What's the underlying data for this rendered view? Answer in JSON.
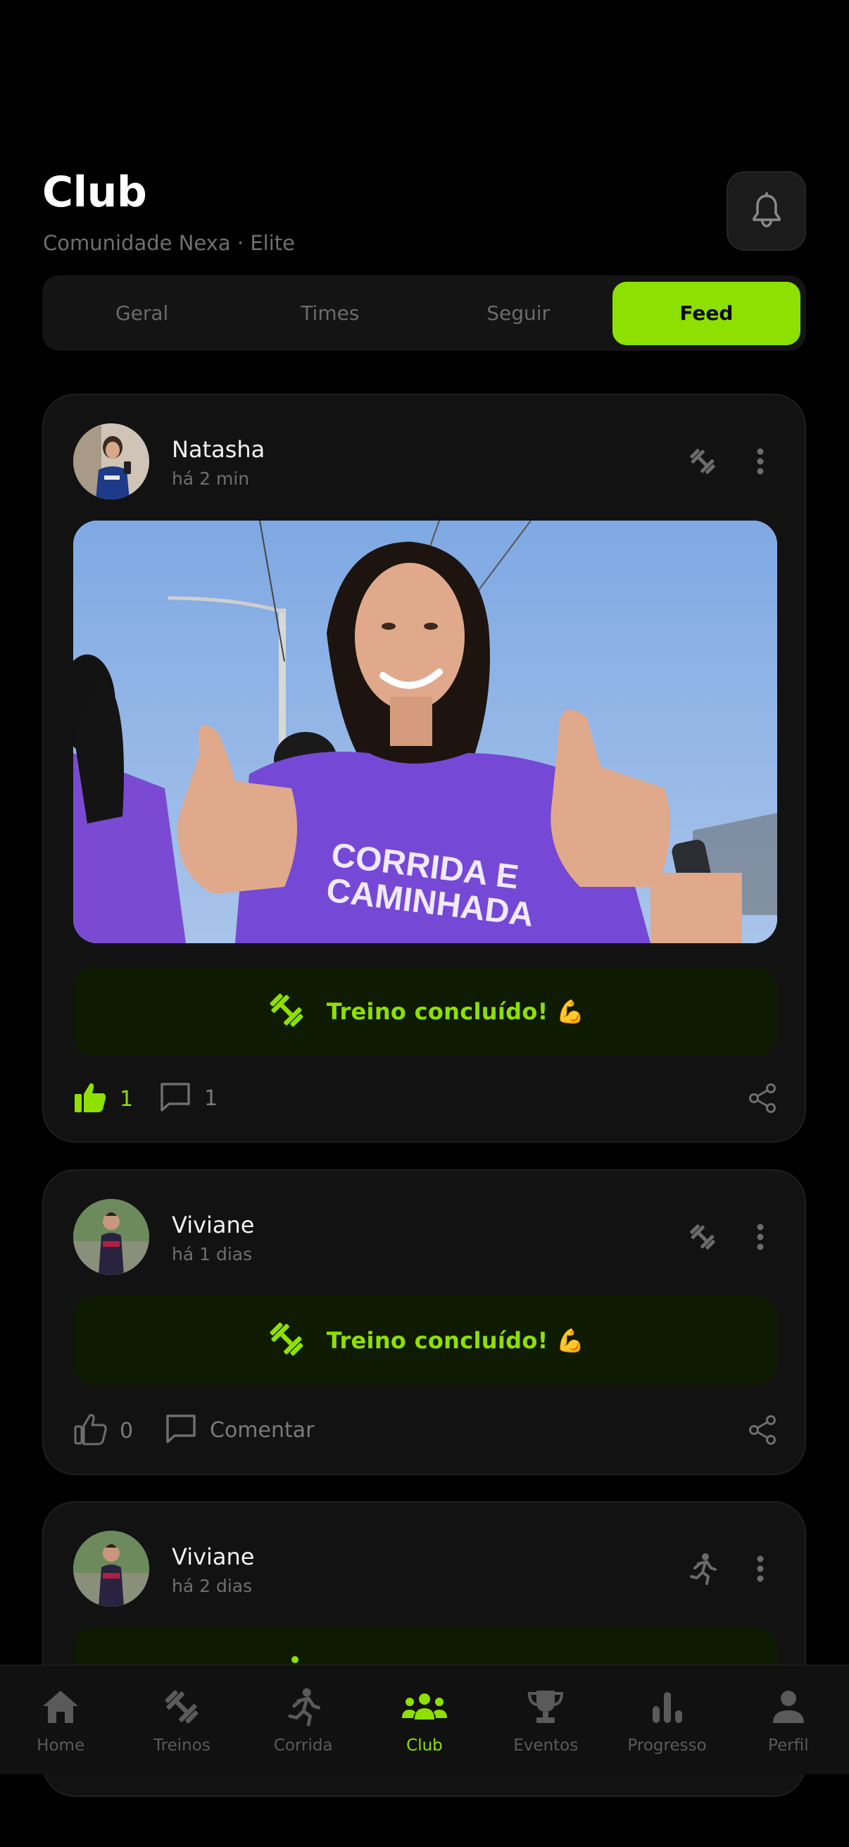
{
  "header": {
    "title": "Club",
    "subtitle": "Comunidade Nexa · Elite",
    "bell_icon": "bell-icon"
  },
  "tabs": [
    {
      "label": "Geral",
      "active": false
    },
    {
      "label": "Times",
      "active": false
    },
    {
      "label": "Seguir",
      "active": false
    },
    {
      "label": "Feed",
      "active": true
    }
  ],
  "posts": [
    {
      "user": "Natasha",
      "time": "há 2 min",
      "activity_icon": "dumbbell-icon",
      "has_photo": true,
      "photo_shirt_text": [
        "CORRIDA E",
        "CAMINHADA"
      ],
      "banner": "Treino concluído! 💪",
      "likes": "1",
      "liked": true,
      "comments": "1"
    },
    {
      "user": "Viviane",
      "time": "há 1 dias",
      "activity_icon": "dumbbell-icon",
      "has_photo": false,
      "banner": "Treino concluído! 💪",
      "likes": "0",
      "liked": false,
      "comments": "Comentar"
    },
    {
      "user": "Viviane",
      "time": "há 2 dias",
      "activity_icon": "running-icon",
      "has_photo": false
    }
  ],
  "nav": [
    {
      "label": "Home",
      "icon": "home-icon"
    },
    {
      "label": "Treinos",
      "icon": "dumbbell-icon"
    },
    {
      "label": "Corrida",
      "icon": "running-icon"
    },
    {
      "label": "Club",
      "icon": "group-icon",
      "active": true
    },
    {
      "label": "Eventos",
      "icon": "trophy-icon"
    },
    {
      "label": "Progresso",
      "icon": "bar-chart-icon"
    },
    {
      "label": "Perfil",
      "icon": "person-icon"
    }
  ],
  "colors": {
    "accent": "#8ee000",
    "background": "#000000",
    "card": "#121212",
    "banner_bg": "#0f1a02",
    "muted": "#6f6f6f"
  }
}
